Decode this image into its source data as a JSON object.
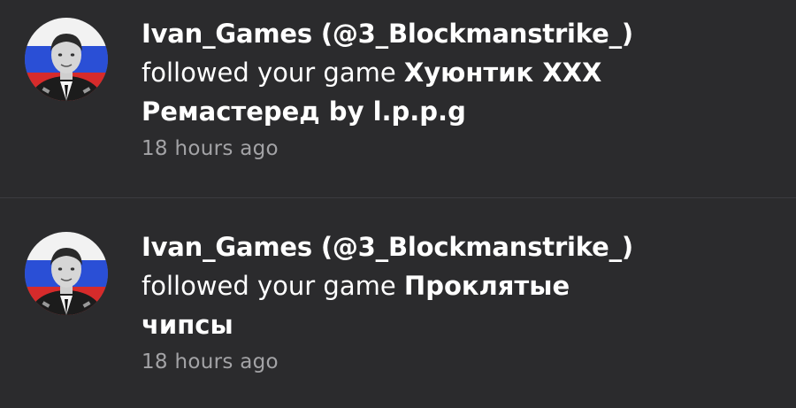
{
  "notifications": [
    {
      "user": "Ivan_Games (@3_Blockmanstrike_)",
      "action": "followed your game",
      "game_line1": "Хуюнтик XXX",
      "game_line2": "Ремастеред by l.p.p.g",
      "time": "18 hours ago"
    },
    {
      "user": "Ivan_Games (@3_Blockmanstrike_)",
      "action": "followed your game",
      "game_line1": "Проклятые",
      "game_line2": "чипсы",
      "time": "18 hours ago"
    }
  ],
  "colors": {
    "background": "#2b2b2d",
    "text": "#ffffff",
    "timestamp": "#a3a3a6",
    "divider": "#3c3c3f",
    "flag_white": "#f2f2f2",
    "flag_blue": "#2a4fd6",
    "flag_red": "#d62b2b"
  }
}
